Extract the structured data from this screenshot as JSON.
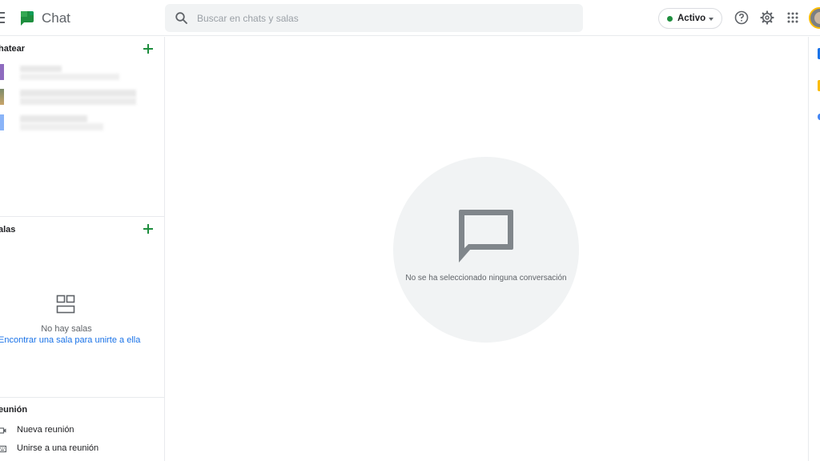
{
  "header": {
    "app_title": "Chat",
    "search_placeholder": "Buscar en chats y salas",
    "status_label": "Activo",
    "status_color": "#1e8e3e",
    "icons": [
      "menu-icon",
      "chat-logo-icon",
      "search-icon",
      "help-icon",
      "gear-icon",
      "apps-grid-icon",
      "avatar"
    ]
  },
  "sidebar": {
    "chat_section": {
      "title": "hatear",
      "chats": [
        {
          "avatar_color": "#8e6bbf"
        },
        {
          "avatar_color": "#8d8a5a"
        },
        {
          "avatar_color": "#8ab4f8"
        }
      ]
    },
    "rooms_section": {
      "title": "alas",
      "empty_text": "No hay salas",
      "find_link": "Encontrar una sala para unirte a ella"
    },
    "meet_section": {
      "title": "eunión",
      "items": [
        {
          "label": "Nueva reunión",
          "icon": "video-icon"
        },
        {
          "label": "Unirse a una reunión",
          "icon": "keyboard-icon"
        }
      ]
    }
  },
  "main": {
    "empty_state_text": "No se ha seleccionado ninguna conversación"
  },
  "colors": {
    "accent_green": "#1e8e3e",
    "link_blue": "#1a73e8",
    "empty_bg": "#f1f3f4"
  }
}
